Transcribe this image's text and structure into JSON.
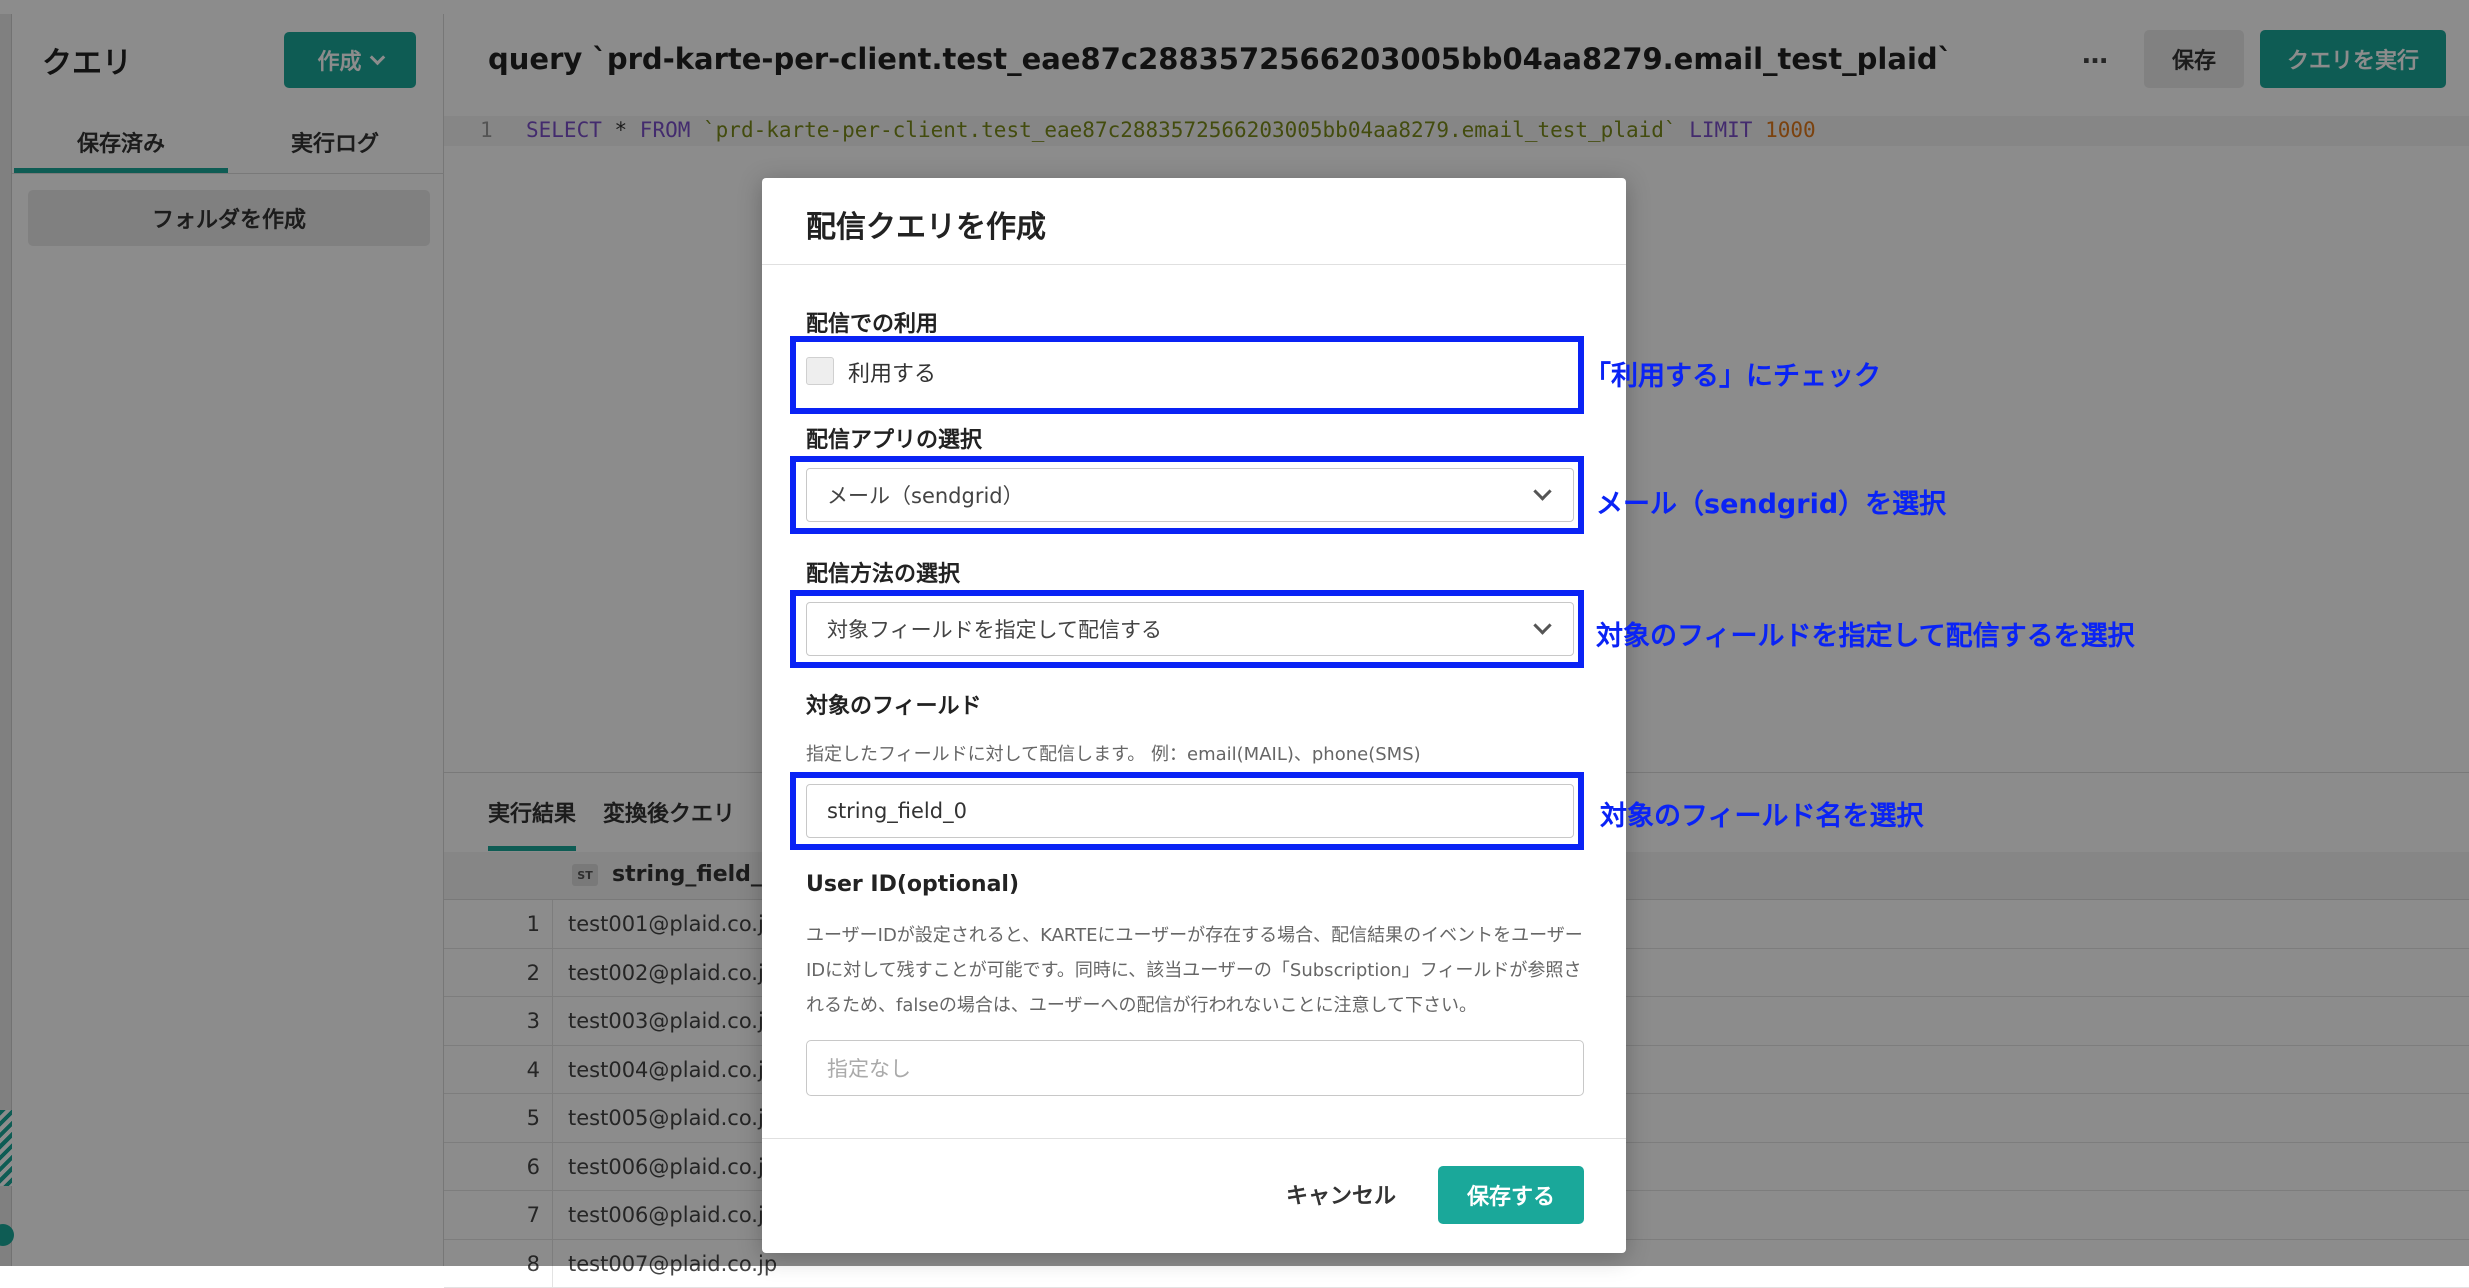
{
  "sidebar": {
    "title": "クエリ",
    "create_button": "作成",
    "tabs": [
      "保存済み",
      "実行ログ"
    ],
    "folder_button": "フォルダを作成"
  },
  "header": {
    "title": "query `prd-karte-per-client.test_eae87c2883572566203005bb04aa8279.email_test_plaid`",
    "more": "…",
    "save": "保存",
    "run": "クエリを実行"
  },
  "editor": {
    "line_number": "1",
    "kw_select": "SELECT",
    "star": " * ",
    "kw_from": "FROM",
    "table": " `prd-karte-per-client.test_eae87c2883572566203005bb04aa8279.email_test_plaid` ",
    "kw_limit": "LIMIT",
    "limit_value": "1000"
  },
  "results": {
    "tabs": [
      "実行結果",
      "変換後クエリ"
    ],
    "column_type": "ST",
    "column_name": "string_field_0",
    "rows": [
      {
        "index": "1",
        "value": "test001@plaid.co.jp"
      },
      {
        "index": "2",
        "value": "test002@plaid.co.jp"
      },
      {
        "index": "3",
        "value": "test003@plaid.co.jp"
      },
      {
        "index": "4",
        "value": "test004@plaid.co.jp"
      },
      {
        "index": "5",
        "value": "test005@plaid.co.jp"
      },
      {
        "index": "6",
        "value": "test006@plaid.co.jp"
      },
      {
        "index": "7",
        "value": "test006@plaid.co.jp"
      },
      {
        "index": "8",
        "value": "test007@plaid.co.jp"
      }
    ]
  },
  "modal": {
    "title": "配信クエリを作成",
    "use_label": "配信での利用",
    "use_checkbox_label": "利用する",
    "use_checked": false,
    "app_label": "配信アプリの選択",
    "app_value": "メール（sendgrid）",
    "method_label": "配信方法の選択",
    "method_value": "対象フィールドを指定して配信する",
    "field_label": "対象のフィールド",
    "field_help": "指定したフィールドに対して配信します。 例：email(MAIL)、phone(SMS)",
    "field_value": "string_field_0",
    "userid_label": "User ID(optional)",
    "userid_help": "ユーザーIDが設定されると、KARTEにユーザーが存在する場合、配信結果のイベントをユーザーIDに対して残すことが可能です。同時に、該当ユーザーの「Subscription」フィールドが参照されるため、falseの場合は、ユーザーへの配信が行われないことに注意して下さい。",
    "userid_placeholder": "指定なし",
    "cancel": "キャンセル",
    "save": "保存する"
  },
  "annotations": {
    "note1": "「利用する」にチェック",
    "note2": "メール（sendgrid）を選択",
    "note3": "対象のフィールドを指定して配信するを選択",
    "note4": "対象のフィールド名を選択"
  },
  "colors": {
    "accent": "#1aa89a",
    "annotation": "#0a23f5"
  }
}
